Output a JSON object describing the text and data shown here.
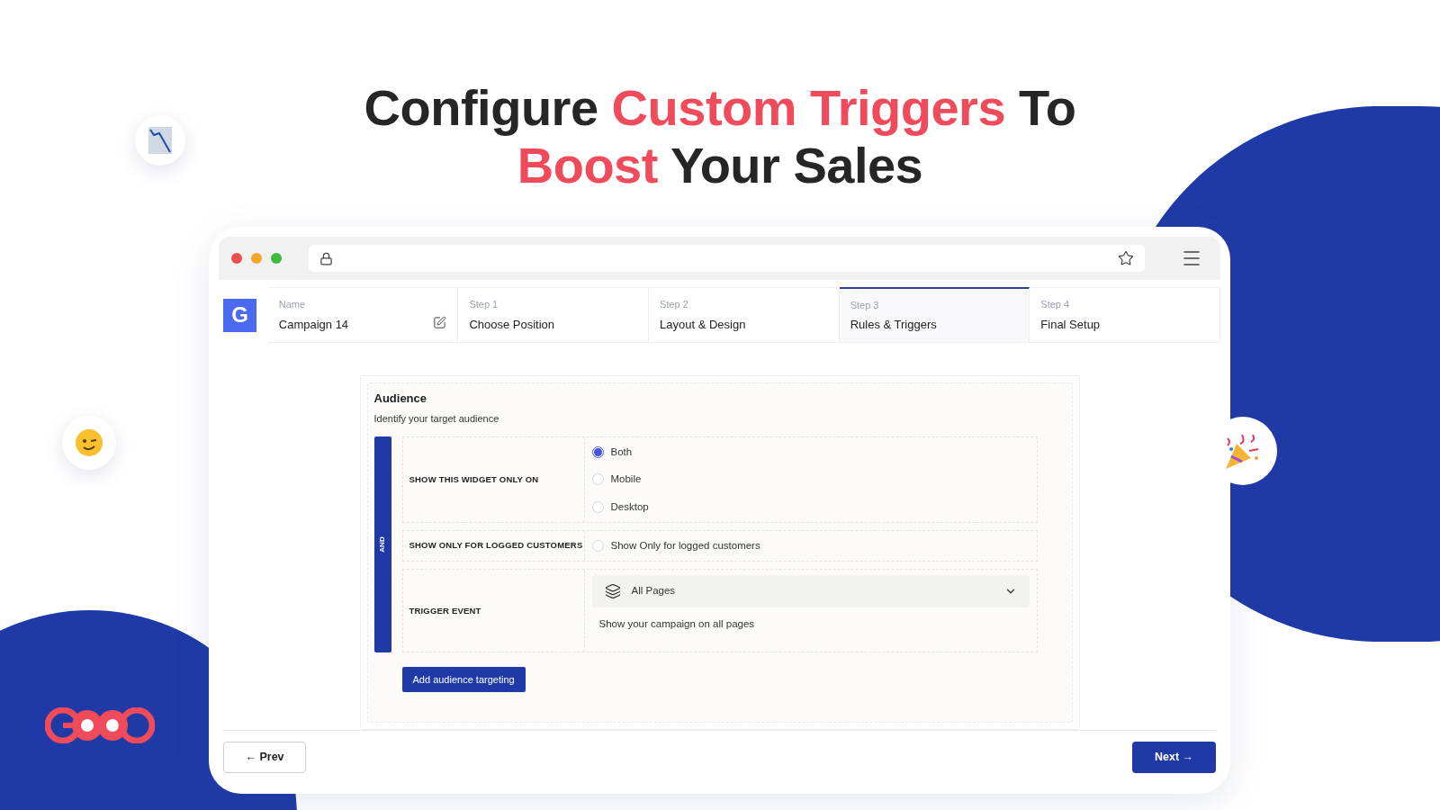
{
  "headline": [
    {
      "text": "Configure ",
      "highlight": false
    },
    {
      "text": "Custom Triggers",
      "highlight": true
    },
    {
      "text": " To ",
      "highlight": false
    },
    {
      "text": "Boost",
      "highlight": true
    },
    {
      "text": " Your Sales",
      "highlight": false
    }
  ],
  "brand": {
    "letter": "G"
  },
  "steps": [
    {
      "label": "Name",
      "value": "Campaign 14",
      "kind": "name",
      "selected": false
    },
    {
      "label": "Step 1",
      "value": "Choose Position",
      "kind": "step",
      "selected": false
    },
    {
      "label": "Step 2",
      "value": "Layout & Design",
      "kind": "step",
      "selected": false
    },
    {
      "label": "Step 3",
      "value": "Rules & Triggers",
      "kind": "step",
      "selected": true
    },
    {
      "label": "Step 4",
      "value": "Final Setup",
      "kind": "step",
      "selected": false
    }
  ],
  "audience": {
    "title": "Audience",
    "subtitle": "Identify your target audience",
    "connector": "AND",
    "rules": [
      {
        "label": "SHOW THIS WIDGET ONLY ON",
        "kind": "radio",
        "options": [
          {
            "label": "Both",
            "selected": true
          },
          {
            "label": "Mobile",
            "selected": false
          },
          {
            "label": "Desktop",
            "selected": false
          }
        ]
      },
      {
        "label": "SHOW ONLY FOR LOGGED CUSTOMERS",
        "kind": "checkbox",
        "options": [
          {
            "label": "Show Only for logged customers",
            "checked": false
          }
        ]
      },
      {
        "label": "TRIGGER EVENT",
        "kind": "select",
        "value": "All Pages",
        "help": "Show your campaign on all pages"
      }
    ],
    "add_button": "Add audience targeting"
  },
  "nav": {
    "prev": "← Prev",
    "next": "Next →"
  }
}
